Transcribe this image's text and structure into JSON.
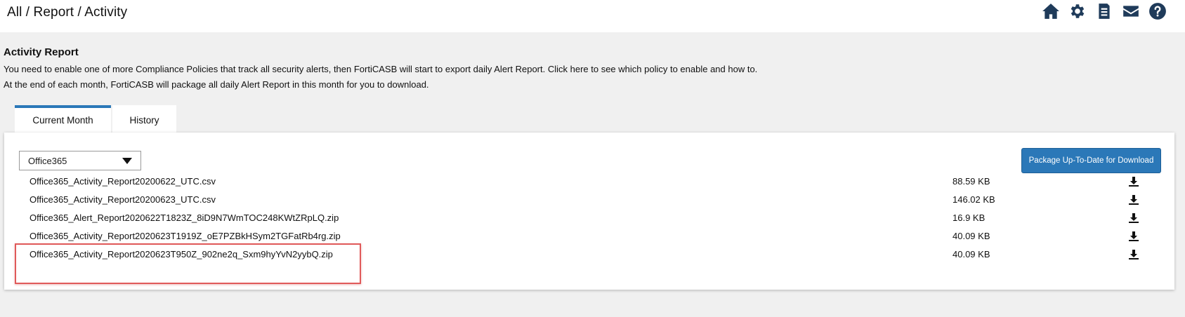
{
  "header": {
    "breadcrumb": "All / Report / Activity",
    "icons": [
      "home-icon",
      "gear-icon",
      "document-icon",
      "mail-icon",
      "help-icon"
    ]
  },
  "page": {
    "title": "Activity Report",
    "description_line1": "You need to enable one of more Compliance Policies that track all security alerts, then FortiCASB will start to export daily Alert Report. Click here to see which policy to enable and how to.",
    "description_line2": "At the end of each month, FortiCASB will package all daily Alert Report in this month for you to download."
  },
  "tabs": [
    {
      "label": "Current Month",
      "active": true
    },
    {
      "label": "History",
      "active": false
    }
  ],
  "panel": {
    "source_select": {
      "value": "Office365"
    },
    "package_button_label": "Package Up-To-Date for Download",
    "files": [
      {
        "name": "Office365_Activity_Report20200622_UTC.csv",
        "size": "88.59 KB"
      },
      {
        "name": "Office365_Activity_Report20200623_UTC.csv",
        "size": "146.02 KB"
      },
      {
        "name": "Office365_Alert_Report2020622T1823Z_8iD9N7WmTOC248KWtZRpLQ.zip",
        "size": "16.9 KB"
      },
      {
        "name": "Office365_Activity_Report2020623T1919Z_oE7PZBkHSym2TGFatRb4rg.zip",
        "size": "40.09 KB"
      },
      {
        "name": "Office365_Activity_Report2020623T950Z_902ne2q_Sxm9hyYvN2yybQ.zip",
        "size": "40.09 KB"
      }
    ]
  },
  "colors": {
    "accent": "#2b78b8",
    "icon": "#1f3b5a",
    "highlight": "#e05a5a",
    "background": "#f0f0f0"
  }
}
